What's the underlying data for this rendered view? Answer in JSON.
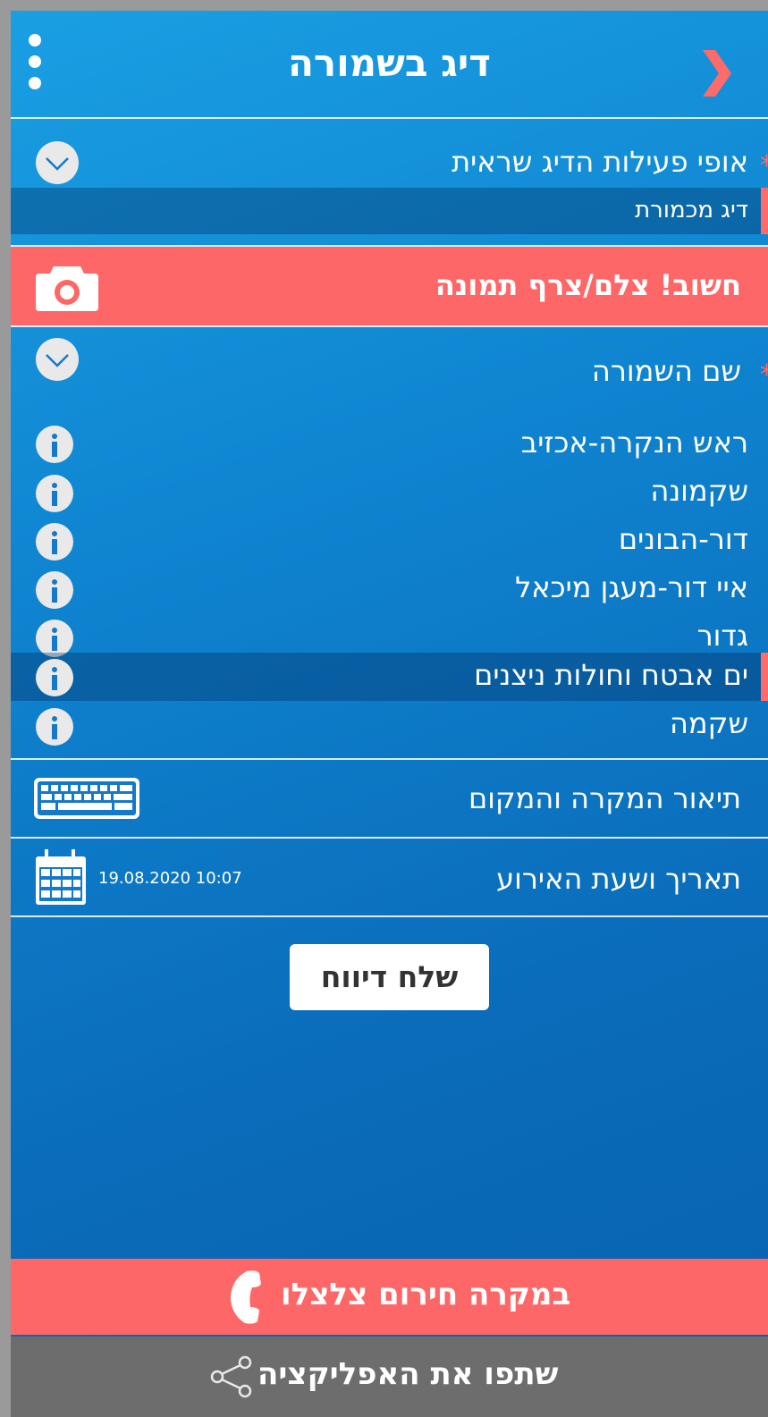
{
  "header": {
    "title": "דיג בשמורה",
    "menu_icon": "more-vert-icon",
    "back_icon": "chevron-right-icon"
  },
  "fishing_type": {
    "label": "אופי פעילות הדיג שראית",
    "required_mark": "*",
    "selected": "דיג מכמורת"
  },
  "photo": {
    "label": "חשוב! צלם/צרף תמונה",
    "icon": "camera-icon"
  },
  "reserve": {
    "label": "שם השמורה",
    "required_mark": "*",
    "items": [
      {
        "label": "ראש הנקרה-אכזיב"
      },
      {
        "label": "שקמונה"
      },
      {
        "label": "דור-הבונים"
      },
      {
        "label": "איי דור-מעגן מיכאל"
      },
      {
        "label": "גדור"
      },
      {
        "label": "ים אבטח וחולות ניצנים"
      },
      {
        "label": "שקמה"
      }
    ],
    "selected_index": 5
  },
  "description": {
    "label": "תיאור המקרה והמקום",
    "icon": "keyboard-icon"
  },
  "datetime": {
    "label": "תאריך ושעת האירוע",
    "value": "19.08.2020 10:07",
    "icon": "calendar-icon"
  },
  "submit": {
    "label": "שלח דיווח"
  },
  "emergency": {
    "label": "במקרה חירום צלצלו",
    "icon": "phone-icon"
  },
  "share": {
    "label": "שתפו את האפליקציה",
    "icon": "share-icon"
  },
  "colors": {
    "accent": "#fe6767",
    "bg_top": "#1a9fe3",
    "bg_bottom": "#0862b0",
    "share_bar": "#6d6d6d"
  }
}
